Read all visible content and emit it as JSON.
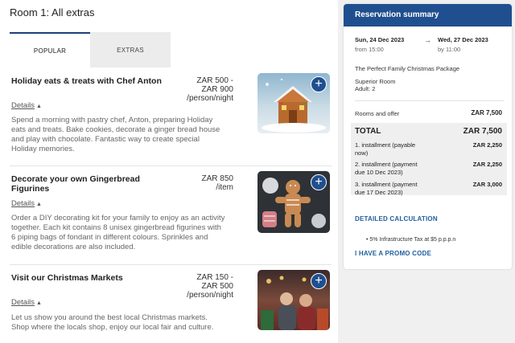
{
  "room_title": "Room 1: All extras",
  "tabs": [
    {
      "label": "POPULAR",
      "active": true
    },
    {
      "label": "EXTRAS",
      "active": false
    }
  ],
  "extras": [
    {
      "name": "Holiday eats & treats with Chef Anton",
      "price_line1": "ZAR 500 -",
      "price_line2": "ZAR 900",
      "price_unit": "/person/night",
      "details_label": "Details",
      "desc_lines": [
        "Spend a morning with pastry chef, Anton, preparing Holiday",
        "eats and treats. Bake cookies, decorate a ginger bread house",
        "and play with chocolate. Fantastic way to create special",
        "Holiday memories."
      ],
      "image_icon": "gingerbread-house-photo"
    },
    {
      "name_line1": "Decorate your own Gingerbread",
      "name_line2": "Figurines",
      "price_line1": "ZAR 850",
      "price_unit": "/item",
      "details_label": "Details",
      "desc_lines": [
        "Order a DIY decorating kit for your family to enjoy as an activity",
        "together. Each kit contains 8 unisex gingerbread figurines with",
        "6 piping bags of fondant in different colours. Sprinkles and",
        "edible decorations are also included."
      ],
      "image_icon": "gingerbread-figurines-photo"
    },
    {
      "name": "Visit our Christmas Markets",
      "price_line1": "ZAR 150 -",
      "price_line2": "ZAR 500",
      "price_unit": "/person/night",
      "details_label": "Details",
      "desc_lines": [
        "Let us show you around the best local Christmas markets.",
        "Shop where the locals shop, enjoy our local fair and culture."
      ],
      "image_icon": "christmas-market-photo"
    }
  ],
  "summary": {
    "header": "Reservation summary",
    "checkin_date": "Sun, 24 Dec 2023",
    "checkin_time": "from 15:00",
    "arrow": "→",
    "checkout_date": "Wed, 27 Dec 2023",
    "checkout_time": "by 11:00",
    "package": "The Perfect Family Christmas Package",
    "room_type": "Superior Room",
    "adults": "Adult: 2",
    "rooms_offer_label": "Rooms and offer",
    "rooms_offer_value": "ZAR 7,500",
    "total_label": "TOTAL",
    "total_value": "ZAR 7,500",
    "installments": [
      {
        "line1": "1. installment (payable",
        "line2": "now)",
        "value": "ZAR 2,250"
      },
      {
        "line1": "2. installment (payment",
        "line2": "due 10 Dec 2023)",
        "value": "ZAR 2,250"
      },
      {
        "line1": "3. installment (payment",
        "line2": "due 17 Dec 2023)",
        "value": "ZAR 3,000"
      }
    ],
    "detailed_calc_label": "DETAILED CALCULATION",
    "tax_line": "5% Infrastructure Tax at $5 p.p.p.n",
    "promo_label": "I HAVE A PROMO CODE"
  },
  "colors": {
    "accent": "#1f4f8f",
    "link": "#1f5f9f"
  }
}
